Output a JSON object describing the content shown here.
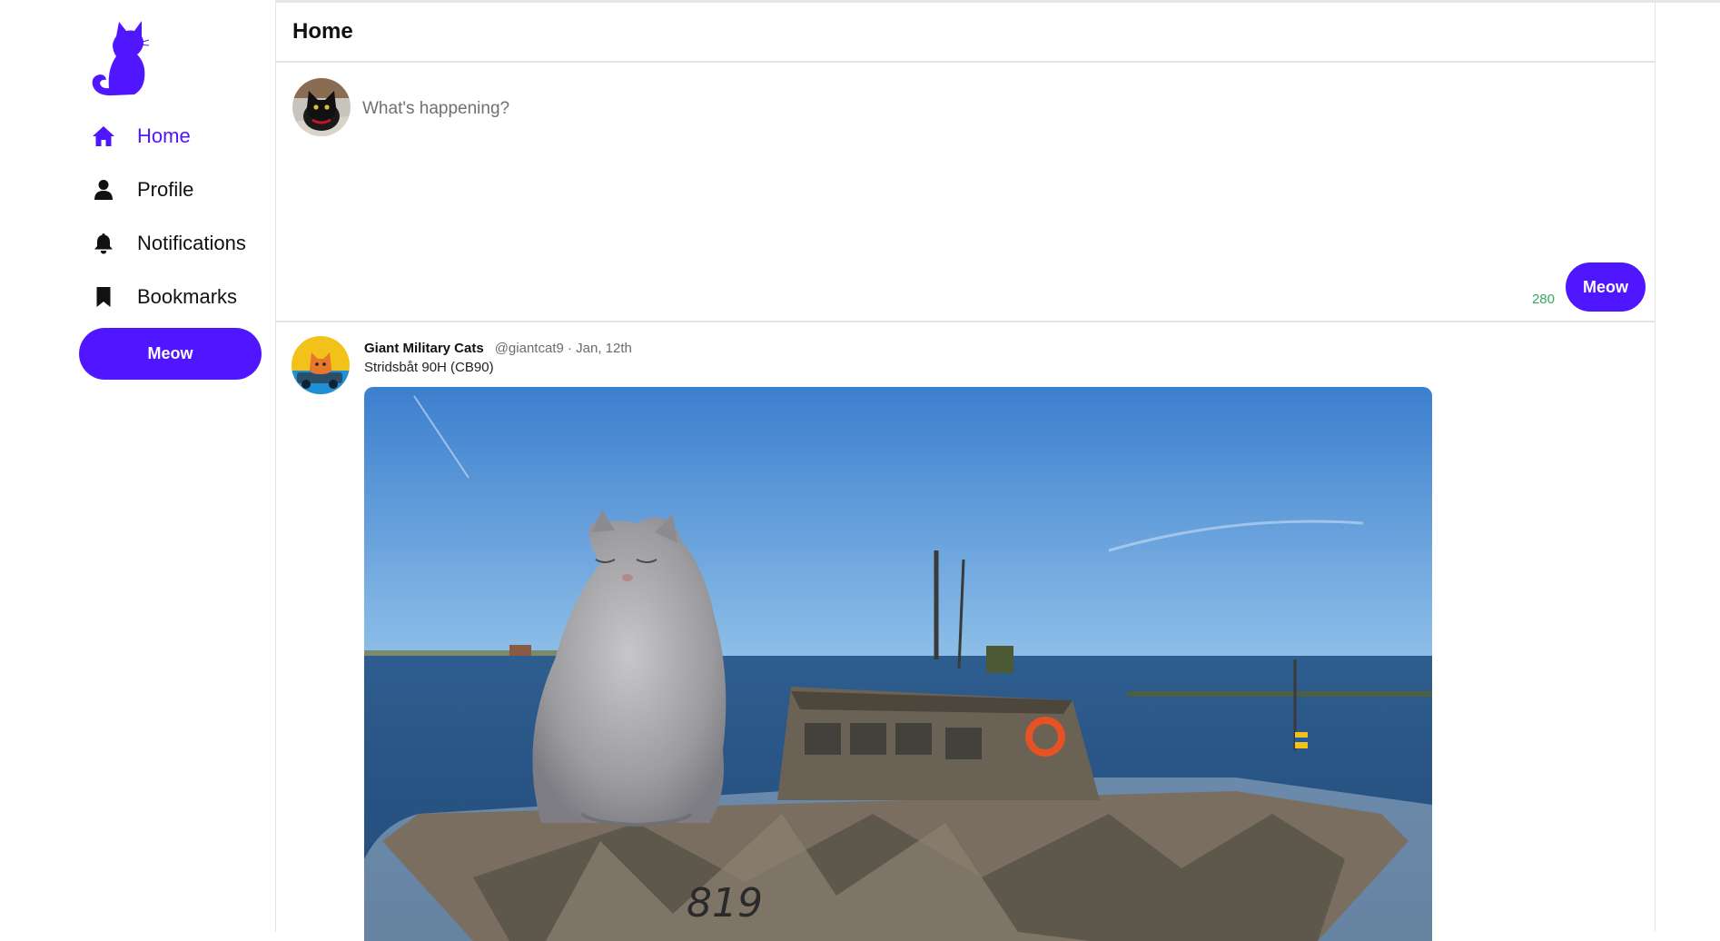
{
  "sidebar": {
    "logo": "cat-logo",
    "items": [
      {
        "label": "Home",
        "icon": "home-icon",
        "active": true
      },
      {
        "label": "Profile",
        "icon": "user-icon",
        "active": false
      },
      {
        "label": "Notifications",
        "icon": "bell-icon",
        "active": false
      },
      {
        "label": "Bookmarks",
        "icon": "bookmark-icon",
        "active": false
      }
    ],
    "button_label": "Meow"
  },
  "header": {
    "title": "Home"
  },
  "composer": {
    "placeholder": "What's happening?",
    "char_count": "280",
    "button_label": "Meow"
  },
  "tweet": {
    "name": "Giant Military Cats",
    "handle": "@giantcat9",
    "date": "Jan, 12th",
    "meta": "@giantcat9 · Jan, 12th",
    "text": "Stridsbåt 90H (CB90)",
    "hull_number": "819"
  },
  "colors": {
    "accent": "#4f16ff",
    "count": "#3aa860",
    "divider": "#e4e4e4"
  }
}
